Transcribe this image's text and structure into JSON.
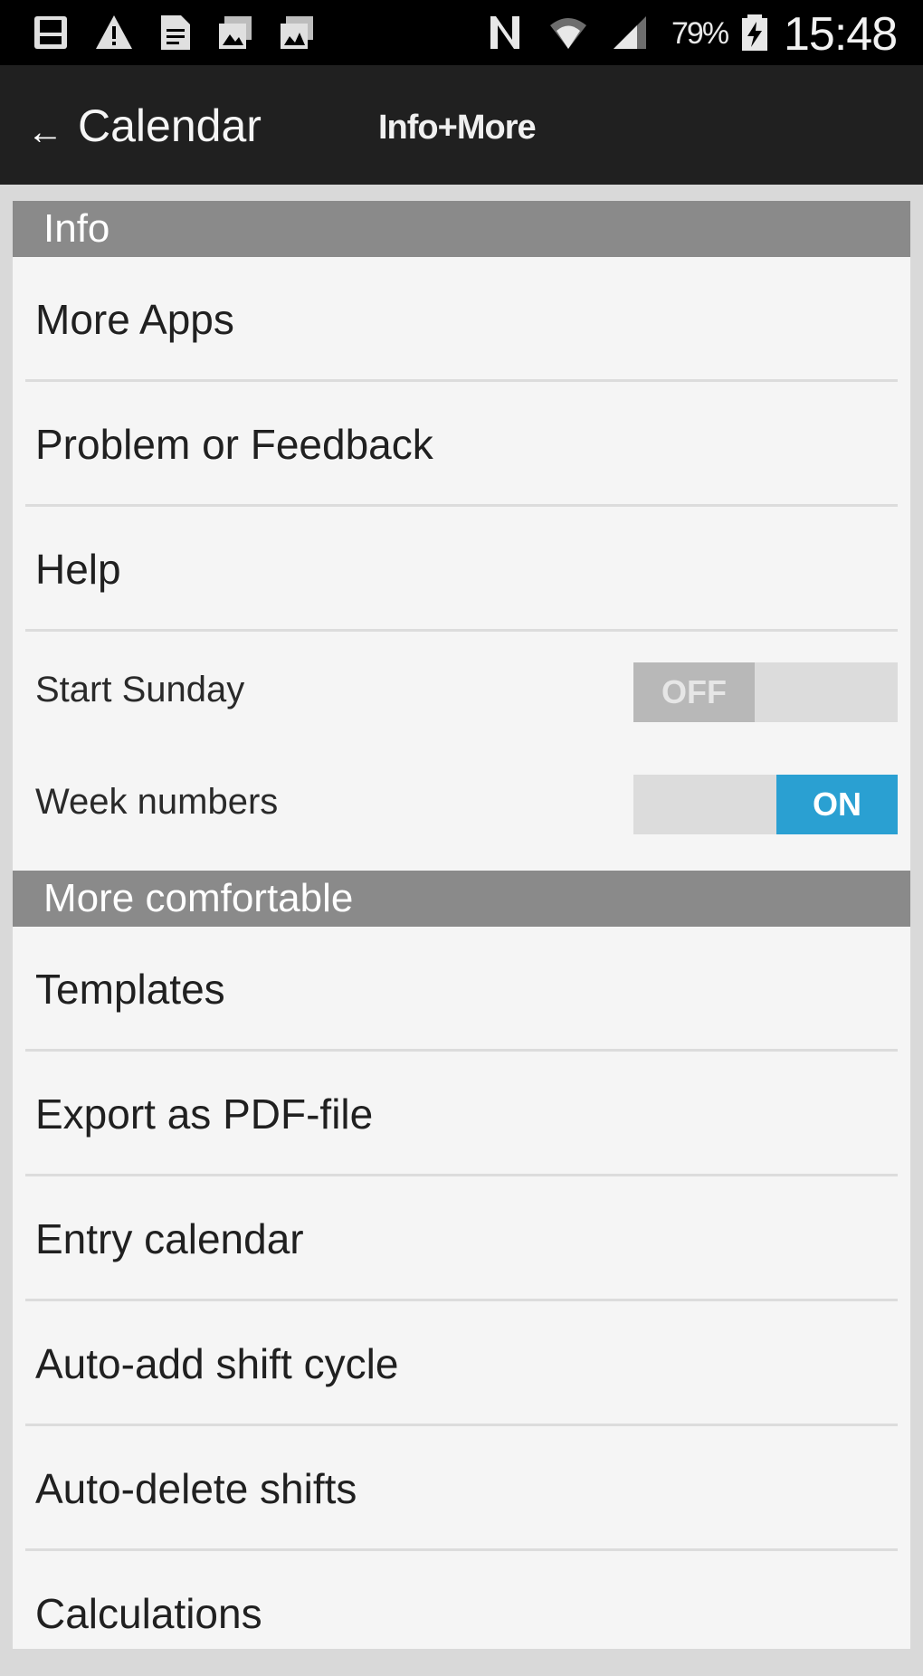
{
  "status_bar": {
    "icons": [
      "sd-card-icon",
      "warning-icon",
      "document-icon",
      "photo-icon",
      "photo-alt-icon",
      "nfc-icon",
      "wifi-icon",
      "signal-icon",
      "battery-charging-icon"
    ],
    "battery_percent": "79%",
    "time": "15:48"
  },
  "action_bar": {
    "back_glyph": "←",
    "title": "Calendar",
    "tab_label": "Info+More"
  },
  "sections": {
    "info": {
      "header": "Info",
      "items": [
        "More Apps",
        "Problem or Feedback",
        "Help"
      ],
      "toggles": [
        {
          "label": "Start Sunday",
          "state_label": "OFF",
          "on": false
        },
        {
          "label": "Week numbers",
          "state_label": "ON",
          "on": true
        }
      ]
    },
    "more_comfortable": {
      "header": "More comfortable",
      "items": [
        "Templates",
        "Export as PDF-file",
        "Entry calendar",
        "Auto-add shift cycle",
        "Auto-delete shifts",
        "Calculations"
      ]
    }
  },
  "colors": {
    "header_bg": "#8a8a8a",
    "toggle_on": "#2aa0d2",
    "action_bar_bg": "#202020"
  }
}
